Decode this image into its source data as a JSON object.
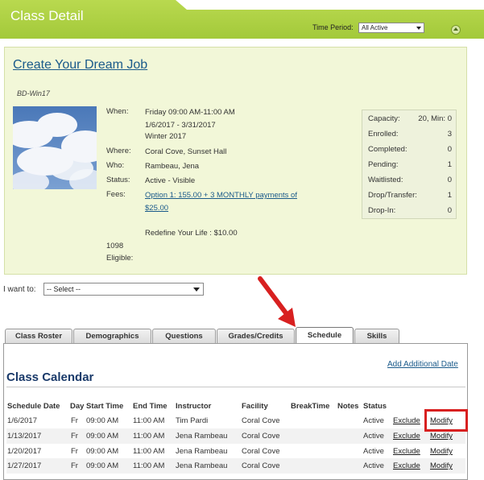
{
  "header": {
    "title": "Class Detail",
    "time_period_label": "Time Period:",
    "time_period_value": "All Active"
  },
  "class": {
    "name": "Create Your Dream Job",
    "code": "BD-Win17",
    "when_label": "When:",
    "when_lines": [
      "Friday 09:00 AM-11:00 AM",
      "1/6/2017 - 3/31/2017",
      "Winter 2017"
    ],
    "where_label": "Where:",
    "where": "Coral Cove, Sunset Hall",
    "who_label": "Who:",
    "who": "Rambeau, Jena",
    "status_label": "Status:",
    "status": "Active - Visible",
    "fees_label": "Fees:",
    "fees_line1": "Option 1: 155.00 + 3 MONTHLY payments of",
    "fees_line2": "$25.00",
    "fees_extra": "Redefine Your Life : $10.00",
    "eligible_number": "1098",
    "eligible_label": "Eligible:"
  },
  "stats": [
    {
      "label": "Capacity:",
      "value": "20, Min: 0"
    },
    {
      "label": "Enrolled:",
      "value": "3"
    },
    {
      "label": "Completed:",
      "value": "0"
    },
    {
      "label": "Pending:",
      "value": "1"
    },
    {
      "label": "Waitlisted:",
      "value": "0"
    },
    {
      "label": "Drop/Transfer:",
      "value": "1"
    },
    {
      "label": "Drop-In:",
      "value": "0"
    }
  ],
  "iwant": {
    "label": "I want to:",
    "value": "-- Select --"
  },
  "tabs": [
    "Class Roster",
    "Demographics",
    "Questions",
    "Grades/Credits",
    "Schedule",
    "Skills"
  ],
  "schedule": {
    "add_link": "Add Additional Date",
    "title": "Class Calendar",
    "headers": [
      "Schedule Date",
      "Day",
      "Start Time",
      "End Time",
      "Instructor",
      "Facility",
      "BreakTime",
      "Notes",
      "Status"
    ],
    "rows": [
      {
        "date": "1/6/2017",
        "day": "Fr",
        "start": "09:00 AM",
        "end": "11:00 AM",
        "instructor": "Tim Pardi",
        "facility": "Coral Cove",
        "status": "Active",
        "exclude": "Exclude",
        "modify": "Modify"
      },
      {
        "date": "1/13/2017",
        "day": "Fr",
        "start": "09:00 AM",
        "end": "11:00 AM",
        "instructor": "Jena Rambeau",
        "facility": "Coral Cove",
        "status": "Active",
        "exclude": "Exclude",
        "modify": "Modify"
      },
      {
        "date": "1/20/2017",
        "day": "Fr",
        "start": "09:00 AM",
        "end": "11:00 AM",
        "instructor": "Jena Rambeau",
        "facility": "Coral Cove",
        "status": "Active",
        "exclude": "Exclude",
        "modify": "Modify"
      },
      {
        "date": "1/27/2017",
        "day": "Fr",
        "start": "09:00 AM",
        "end": "11:00 AM",
        "instructor": "Jena Rambeau",
        "facility": "Coral Cove",
        "status": "Active",
        "exclude": "Exclude",
        "modify": "Modify"
      }
    ]
  },
  "colors": {
    "header_green": "#a3c93a",
    "panel_bg": "#f2f7d8",
    "link_blue": "#1a5a8a",
    "annotation_red": "#d82020"
  }
}
